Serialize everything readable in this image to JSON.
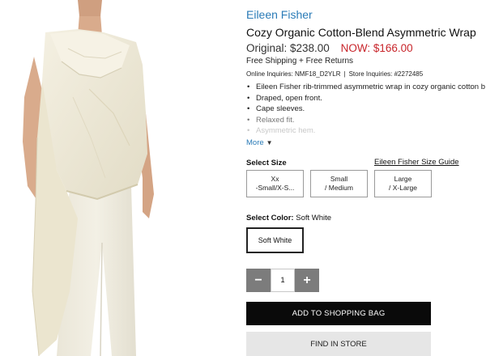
{
  "product": {
    "brand": "Eileen Fisher",
    "title": "Cozy Organic Cotton-Blend Asymmetric Wrap",
    "original_price": "Original: $238.00",
    "now_price": "NOW: $166.00",
    "shipping": "Free Shipping + Free Returns",
    "online_inquiries": "Online Inquiries: NMF18_D2YLR",
    "inquiries_separator": "|",
    "store_inquiries": "Store Inquiries: #2272485",
    "features": [
      "Eileen Fisher rib-trimmed asymmetric wrap in cozy organic cotton b",
      "Draped, open front.",
      "Cape sleeves.",
      "Relaxed fit.",
      "Asymmetric hem."
    ],
    "more_label": "More",
    "more_icon": "chevron-down-icon",
    "image_alt": "model-wearing-ivory-wrap"
  },
  "size": {
    "label": "Select Size",
    "guide_label": "Eileen Fisher Size Guide",
    "options": [
      {
        "line1": "Xx",
        "line2": "-Small/X-S..."
      },
      {
        "line1": "Small",
        "line2": "/ Medium"
      },
      {
        "line1": "Large",
        "line2": "/ X-Large"
      }
    ]
  },
  "color": {
    "label": "Select Color:",
    "value": "Soft White",
    "swatch_label": "Soft White"
  },
  "quantity": {
    "minus_label": "−",
    "value": "1",
    "plus_label": "+"
  },
  "actions": {
    "add_to_bag": "ADD TO SHOPPING BAG",
    "find_in_store": "FIND IN STORE"
  },
  "colors": {
    "brand_link": "#2a7bb7",
    "sale_price": "#c8252b",
    "primary_button": "#0a0a0a",
    "secondary_button": "#e6e6e6",
    "stepper_button": "#7c7c7c",
    "garment": "#efead8"
  }
}
